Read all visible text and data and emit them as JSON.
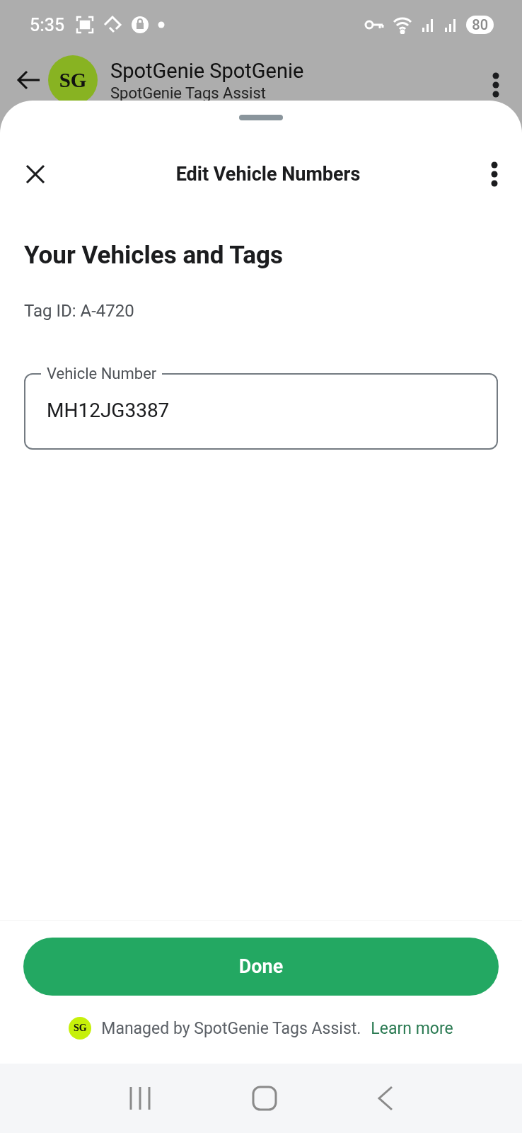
{
  "status_bar": {
    "time": "5:35",
    "battery": "80"
  },
  "chat_header": {
    "avatar": "SG",
    "title": "SpotGenie SpotGenie",
    "subtitle": "SpotGenie Tags Assist"
  },
  "sheet": {
    "title": "Edit Vehicle Numbers",
    "heading": "Your Vehicles and Tags",
    "tag_id": "Tag ID: A-4720",
    "field": {
      "label": "Vehicle Number",
      "value": "MH12JG3387"
    },
    "done_button": "Done",
    "footer": {
      "badge": "SG",
      "text": "Managed by SpotGenie Tags Assist.",
      "link": "Learn more"
    }
  }
}
